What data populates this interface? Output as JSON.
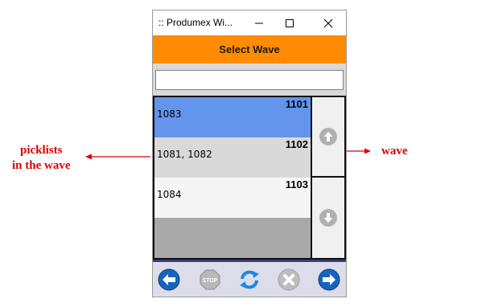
{
  "window": {
    "title": ":: Produmex Wi..."
  },
  "header": {
    "title": "Select Wave"
  },
  "search": {
    "value": ""
  },
  "waves": [
    {
      "wave": "1101",
      "picklists": "1083",
      "color": "#6495ed"
    },
    {
      "wave": "1102",
      "picklists": "1081, 1082",
      "color": "#d9d9d9"
    },
    {
      "wave": "1103",
      "picklists": "1084",
      "color": "#f5f5f5"
    }
  ],
  "annotations": {
    "picklists": [
      "picklists",
      "in the wave"
    ],
    "wave": "wave"
  },
  "colors": {
    "accent": "#ff8c00",
    "annotation": "#dd0000",
    "selected": "#6495ed"
  },
  "toolbar": {
    "icons": [
      "back-arrow-icon",
      "stop-icon",
      "refresh-icon",
      "cancel-icon",
      "forward-arrow-icon"
    ]
  }
}
